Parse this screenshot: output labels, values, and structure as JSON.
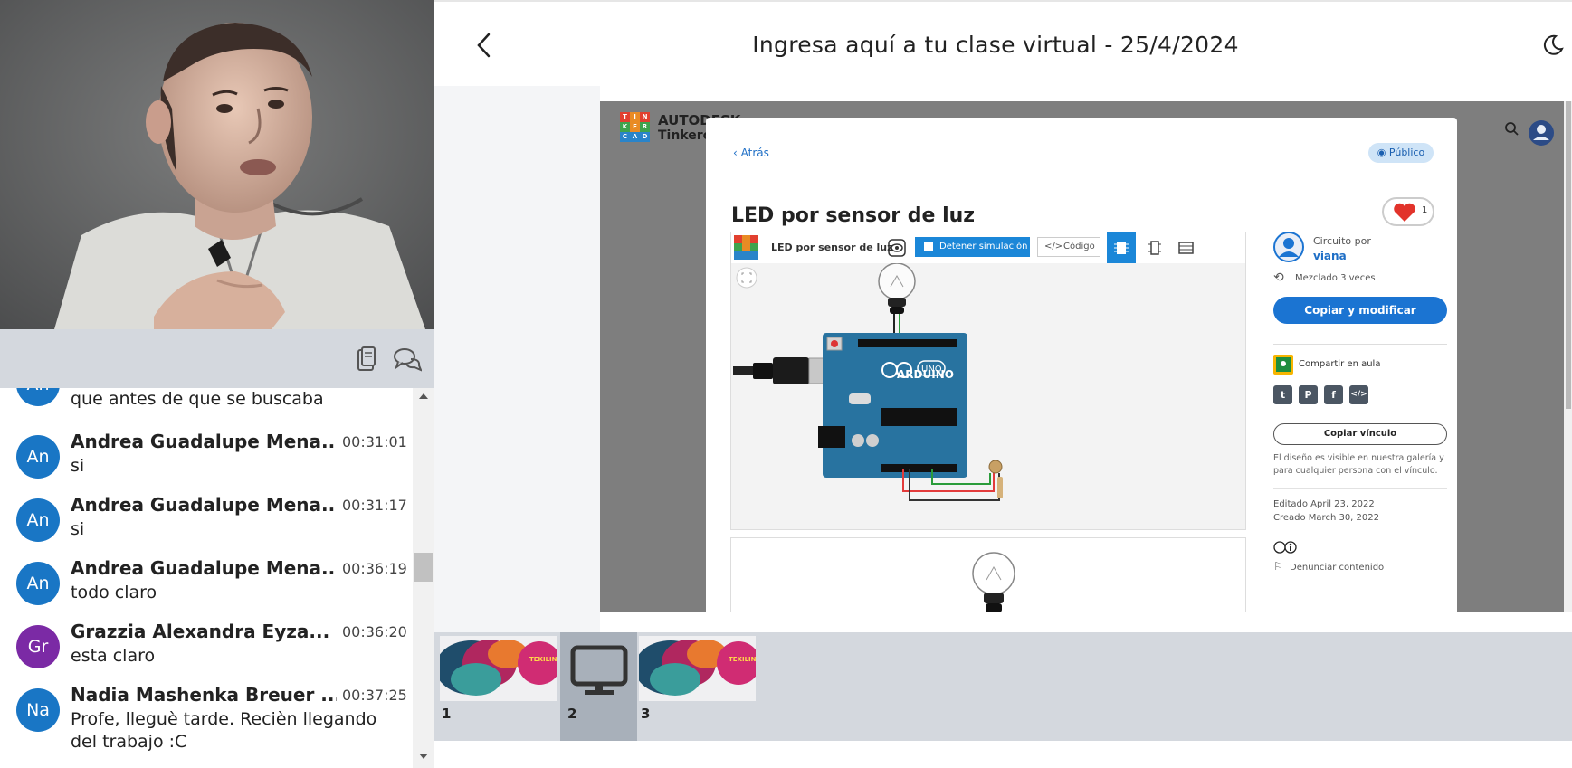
{
  "header": {
    "title": "Ingresa aquí a tu clase virtual - 25/4/2024"
  },
  "chat": {
    "partial_text": "que antes de que se buscaba",
    "partial_initials": "An",
    "messages": [
      {
        "initials": "An",
        "color": "#1976c5",
        "name": "Andrea Guadalupe Mena...",
        "time": "00:31:01",
        "text": "si"
      },
      {
        "initials": "An",
        "color": "#1976c5",
        "name": "Andrea Guadalupe Mena...",
        "time": "00:31:17",
        "text": "si"
      },
      {
        "initials": "An",
        "color": "#1976c5",
        "name": "Andrea Guadalupe Mena...",
        "time": "00:36:19",
        "text": "todo claro"
      },
      {
        "initials": "Gr",
        "color": "#7b2aa5",
        "name": "Grazzia Alexandra Eyza...",
        "time": "00:36:20",
        "text": "esta claro"
      },
      {
        "initials": "Na",
        "color": "#1976c5",
        "name": "Nadia Mashenka Breuer ...",
        "time": "00:37:25",
        "text": "Profe, lleguè tarde. Recièn llegando del trabajo :C"
      }
    ]
  },
  "tinkercad": {
    "logo_letters": [
      "T",
      "I",
      "N",
      "K",
      "E",
      "R",
      "C",
      "A",
      "D"
    ],
    "brand_line1": "AUTODESK",
    "brand_line2": "Tinkercad",
    "back_label": "Atrás",
    "visibility_badge": "Público",
    "design_title": "LED por sensor de luz",
    "likes": "1",
    "sim_name": "LED por sensor de luz",
    "stop_button": "Detener simulación",
    "code_button": "Código",
    "circuit_by_label": "Circuito por",
    "author": "viana",
    "remixed": "Mezclado 3 veces",
    "copy_modify": "Copiar y modificar",
    "share_classroom": "Compartir en aula",
    "social": [
      "t",
      "P",
      "f",
      "</>"
    ],
    "copy_link": "Copiar vínculo",
    "visibility_note": "El diseño es visible en nuestra galería y para cualquier persona con el vínculo.",
    "edited": "Editado April 23, 2022",
    "created": "Creado March 30, 2022",
    "report": "Denunciar contenido",
    "board_label": "UNO",
    "board_brand": "ARDUINO"
  },
  "slides": [
    {
      "number": "1",
      "thumb_text": "TEKILIN LABS TEC"
    },
    {
      "number": "2",
      "thumb_text": ""
    },
    {
      "number": "3",
      "thumb_text": "TEKILIN LABS TEC"
    }
  ],
  "colors": {
    "accent_blue": "#1b74d2",
    "chat_avatar_blue": "#1976c5",
    "chat_avatar_purple": "#7b2aa5",
    "toolbar_gray": "#d4d8de",
    "selected_slide": "#a8b0ba"
  },
  "icons": {
    "back": "chevron-left-icon",
    "theme": "moon-icon",
    "notes": "clipboard-icon",
    "chat": "chat-bubbles-icon",
    "search": "search-icon"
  }
}
